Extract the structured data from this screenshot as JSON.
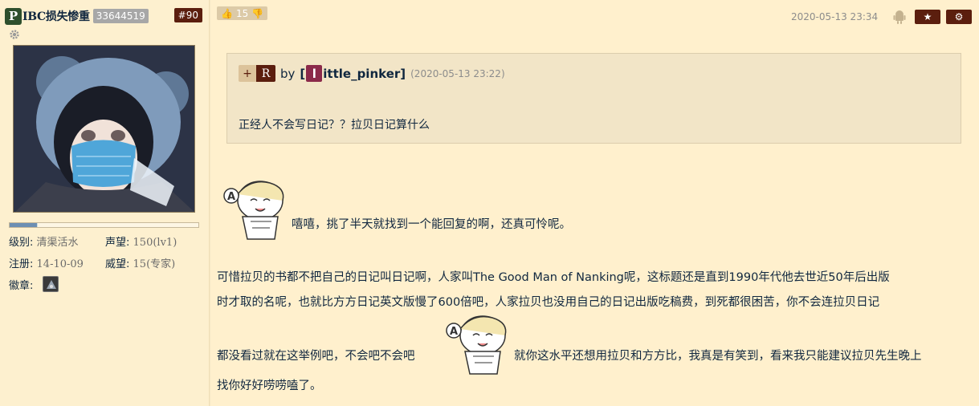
{
  "user": {
    "badge_letter": "P",
    "name": "IBC损失惨重",
    "uid": "33644519",
    "floor": "#90",
    "progress": 0.15,
    "stats": {
      "level_label": "级别:",
      "level_value": "清渠活水",
      "fame_label": "声望:",
      "fame_value": "150(lv1)",
      "reg_label": "注册:",
      "reg_value": "14-10-09",
      "prestige_label": "威望:",
      "prestige_value": "15(专家)",
      "medal_label": "徽章:"
    }
  },
  "post": {
    "likes": "15",
    "timestamp": "2020-05-13 23:34",
    "star_icon": "★",
    "gear_icon": "⚙",
    "quote": {
      "plus": "+",
      "r": "R",
      "by": "by",
      "author_open": "[",
      "author_first": "l",
      "author_rest": "ittle_pinker",
      "author_close": "]",
      "time": "(2020-05-13 23:22)",
      "text": "正经人不会写日记？？拉贝日记算什么"
    },
    "line1": "嘻嘻，挑了半天就找到一个能回复的啊，还真可怜呢。",
    "line2": "可惜拉贝的书都不把自己的日记叫日记啊，人家叫The Good Man of Nanking呢，这标题还是直到1990年代他去世近50年后出版",
    "line3": "时才取的名呢，也就比方方日记英文版慢了600倍吧，人家拉贝也没用自己的日记出版吃稿费，到死都很困苦，你不会连拉贝日记",
    "line4a": "都没看过就在这举例吧，不会吧不会吧",
    "line4b": "就你这水平还想用拉贝和方方比，我真是有笑到，看来我只能建议拉贝先生晚上",
    "line5": "找你好好唠唠嗑了。"
  }
}
